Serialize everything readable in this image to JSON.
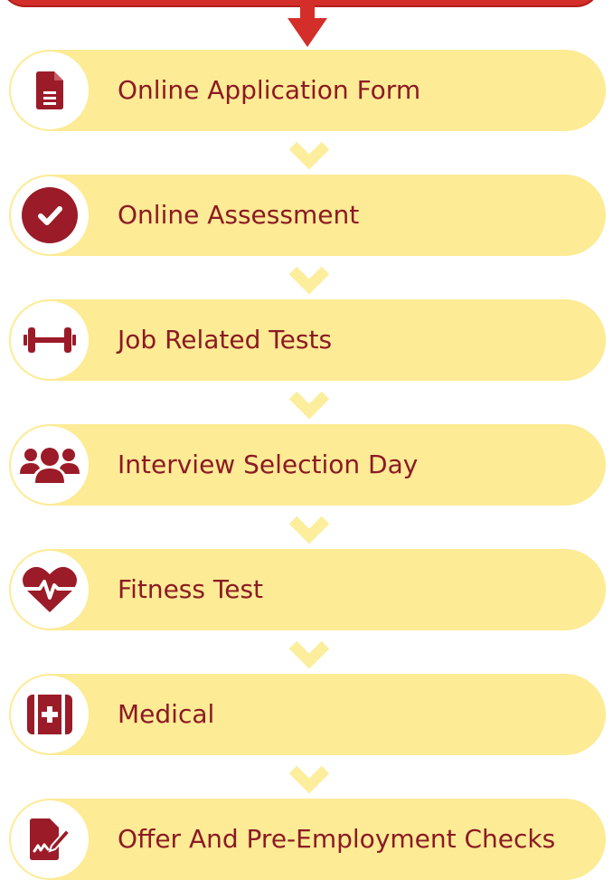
{
  "colors": {
    "accent": "#d42e2a",
    "step_fill": "#fdeb95",
    "chevron": "#fcee9c",
    "icon": "#9b1b28",
    "text": "#8b1a24"
  },
  "steps": [
    {
      "label": "Online Application Form",
      "icon": "document-icon"
    },
    {
      "label": "Online Assessment",
      "icon": "checkmark-circle-icon"
    },
    {
      "label": "Job Related Tests",
      "icon": "dumbbell-icon"
    },
    {
      "label": "Interview Selection Day",
      "icon": "users-group-icon"
    },
    {
      "label": "Fitness Test",
      "icon": "heartbeat-icon"
    },
    {
      "label": "Medical",
      "icon": "medical-kit-icon"
    },
    {
      "label": "Offer And Pre-Employment Checks",
      "icon": "signed-document-icon"
    }
  ]
}
